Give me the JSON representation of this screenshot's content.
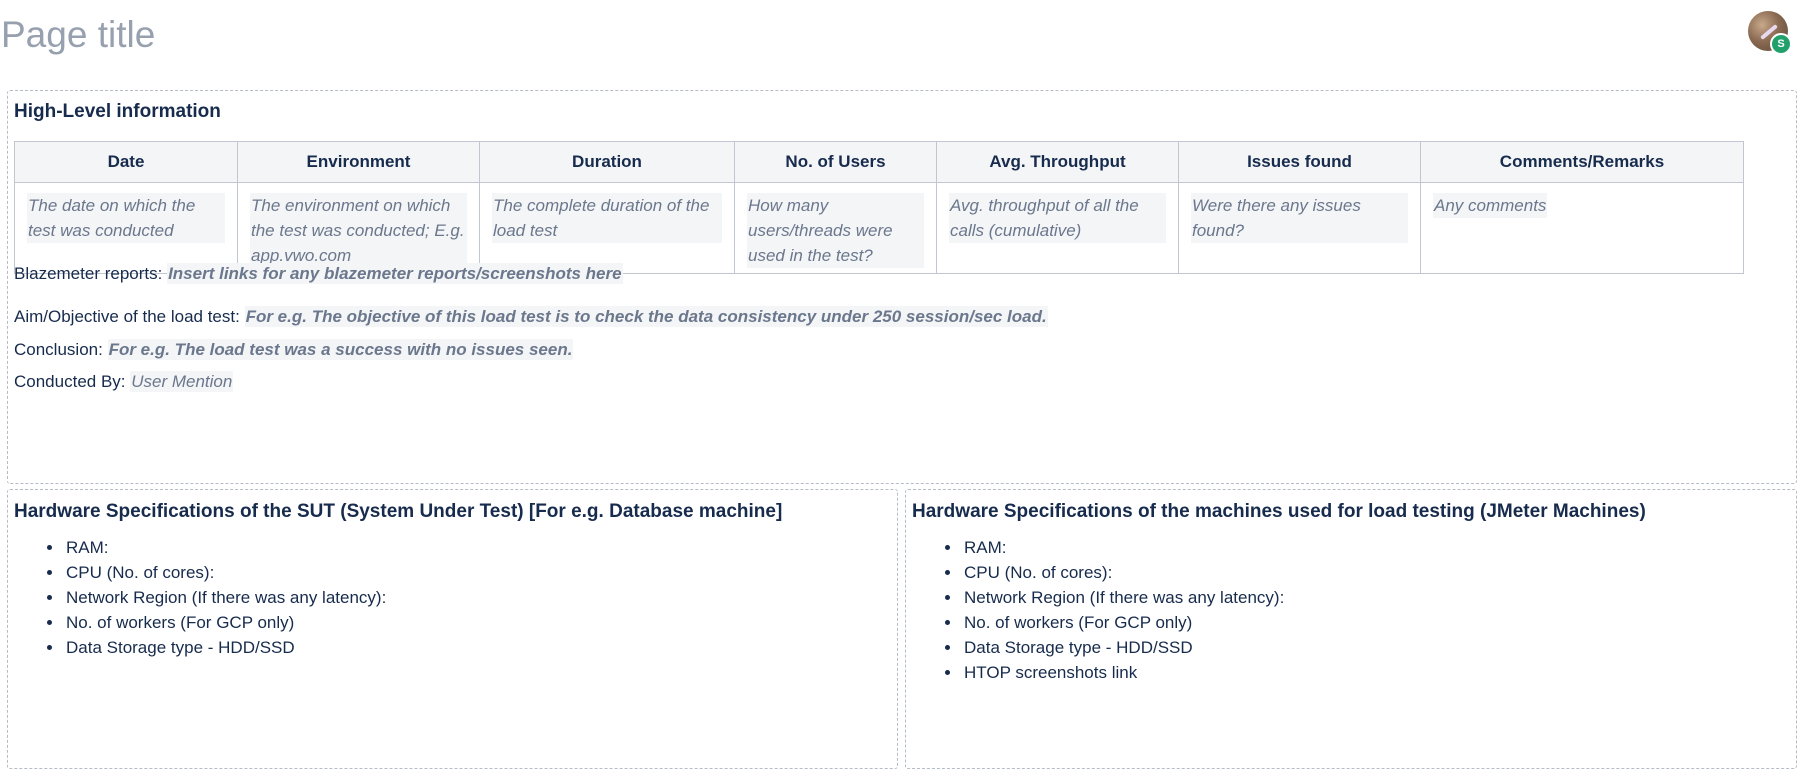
{
  "page": {
    "title": "Page title",
    "avatar_badge": "S"
  },
  "high_level": {
    "heading": "High-Level information",
    "columns": [
      "Date",
      "Environment",
      "Duration",
      "No. of Users",
      "Avg. Throughput",
      "Issues found",
      "Comments/Remarks"
    ],
    "cells": [
      "The date on which the test was conducted",
      "The environment on which the test was conducted; E.g. app.vwo.com",
      "The complete duration of the load test",
      "How many users/threads were used in the test?",
      "Avg. throughput of all the calls (cumulative)",
      "Were there any issues found?",
      "Any comments"
    ],
    "blazemeter_label": "Blazemeter reports:",
    "blazemeter_value": "Insert links for any blazemeter reports/screenshots here",
    "aim_label": "Aim/Objective of the load test:",
    "aim_value": "For e.g. The objective of this load test is to check the data consistency under 250 session/sec load.",
    "conclusion_label": "Conclusion:",
    "conclusion_value": "For e.g. The load test was a success with no issues seen.",
    "conducted_label": "Conducted By:",
    "conducted_value": "User Mention"
  },
  "sut": {
    "heading": "Hardware Specifications of the SUT (System Under Test) [For e.g. Database machine]",
    "items": [
      "RAM:",
      "CPU (No. of cores):",
      "Network Region (If there was any latency):",
      "No. of workers (For GCP only)",
      "Data Storage type - HDD/SSD"
    ]
  },
  "jmeter": {
    "heading": "Hardware Specifications of the machines used for load testing (JMeter Machines)",
    "items": [
      "RAM:",
      "CPU (No. of cores):",
      "Network Region (If there was any latency):",
      "No. of workers (For GCP only)",
      "Data Storage type - HDD/SSD",
      "HTOP screenshots link"
    ]
  },
  "colors": {
    "text": "#172b4d",
    "placeholder": "#6b778c",
    "placeholder_bg": "#f4f5f7",
    "title": "#97a0af",
    "badge": "#22a06b"
  }
}
